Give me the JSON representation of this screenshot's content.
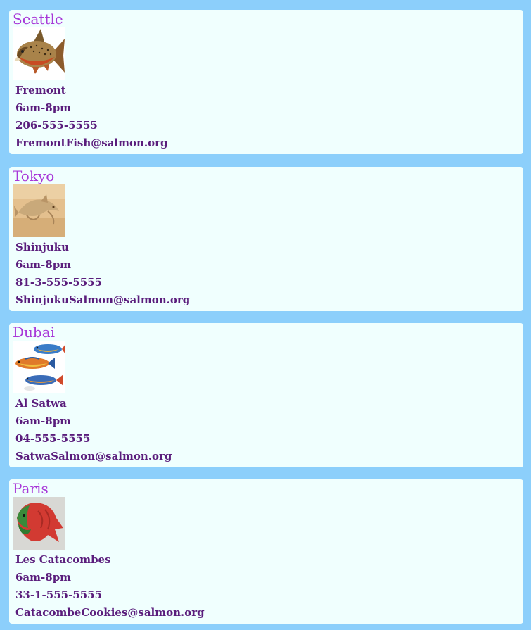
{
  "locations": [
    {
      "city": "Seattle",
      "image_icon": "salmon-photo-icon",
      "neighborhood": "Fremont",
      "hours": "6am-8pm",
      "phone": "206-555-5555",
      "email": "FremontFish@salmon.org"
    },
    {
      "city": "Tokyo",
      "image_icon": "salmon-painting-icon",
      "neighborhood": "Shinjuku",
      "hours": "6am-8pm",
      "phone": "81-3-555-5555",
      "email": "ShinjukuSalmon@salmon.org"
    },
    {
      "city": "Dubai",
      "image_icon": "three-fish-drawing-icon",
      "neighborhood": "Al Satwa",
      "hours": "6am-8pm",
      "phone": "04-555-5555",
      "email": "SatwaSalmon@salmon.org"
    },
    {
      "city": "Paris",
      "image_icon": "fish-cookie-icon",
      "neighborhood": "Les Catacombes",
      "hours": "6am-8pm",
      "phone": "33-1-555-5555",
      "email": "CatacombeCookies@salmon.org"
    }
  ],
  "colors": {
    "page_background": "#8ccffb",
    "card_background": "#f0fffe",
    "city_heading": "#a838d8",
    "detail_text": "#5a1d7c"
  }
}
